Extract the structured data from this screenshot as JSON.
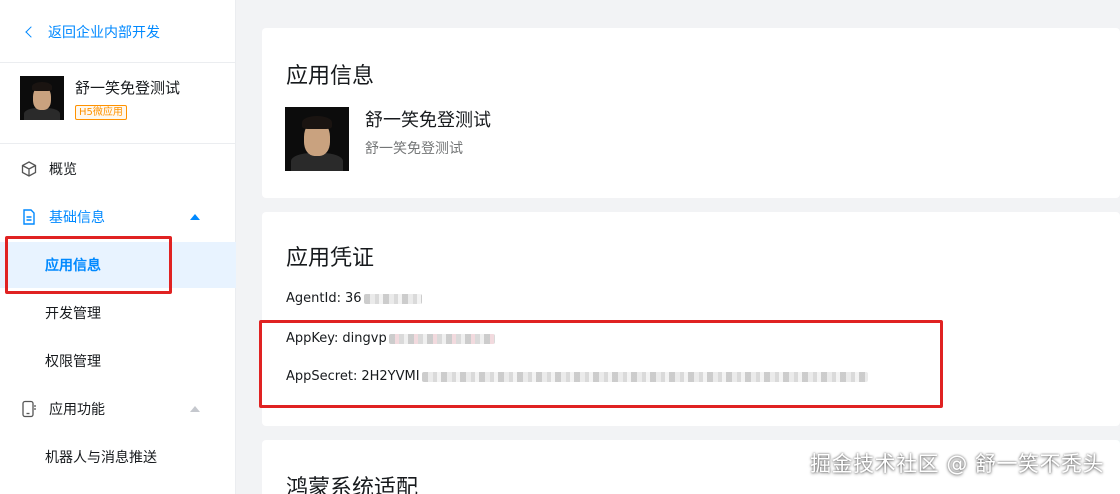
{
  "sidebar": {
    "back_label": "返回企业内部开发",
    "app": {
      "name": "舒一笑免登测试",
      "badge": "H5微应用"
    },
    "items": [
      {
        "label": "概览",
        "icon": "cube-icon"
      },
      {
        "label": "基础信息",
        "icon": "document-icon",
        "expanded": true
      },
      {
        "label": "应用信息",
        "selected": true
      },
      {
        "label": "开发管理"
      },
      {
        "label": "权限管理"
      },
      {
        "label": "应用功能",
        "icon": "phone-app-icon",
        "expanded": false
      },
      {
        "label": "机器人与消息推送"
      }
    ]
  },
  "main": {
    "app_info": {
      "title": "应用信息",
      "name": "舒一笑免登测试",
      "description": "舒一笑免登测试"
    },
    "credentials": {
      "title": "应用凭证",
      "agent_id_label": "AgentId:",
      "agent_id_value": "36",
      "app_key_label": "AppKey:",
      "app_key_value": "dingvp",
      "app_secret_label": "AppSecret:",
      "app_secret_value": "2H2YVMI"
    },
    "harmony": {
      "title": "鸿蒙系统适配"
    }
  },
  "watermark": "掘金技术社区 @ 舒一笑不秃头",
  "colors": {
    "accent": "#0089ff",
    "highlight_box": "#e02222",
    "badge": "#ff9200"
  }
}
